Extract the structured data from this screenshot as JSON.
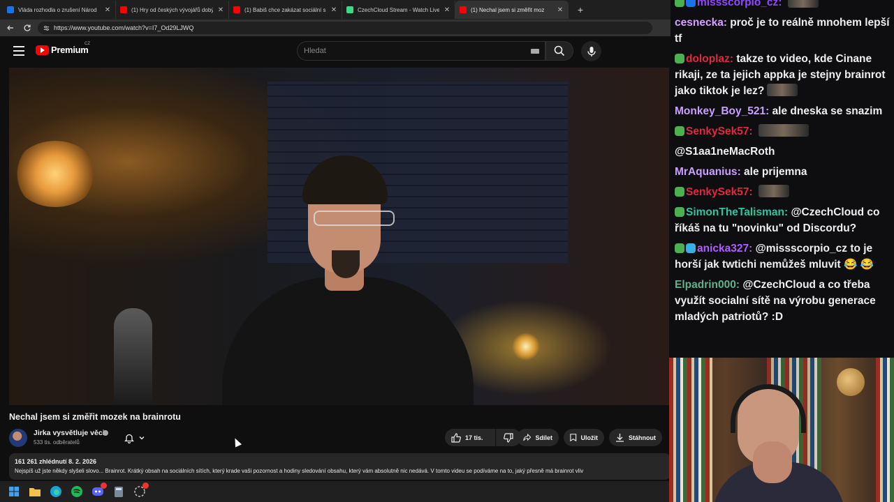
{
  "browser": {
    "tabs": [
      {
        "label": "Vláda rozhodla o zrušení Národ",
        "favicon_color": "#1a73e8",
        "active": false
      },
      {
        "label": "(1) Hry od českých vývojářů dobýv",
        "favicon_color": "#ff0000",
        "active": false
      },
      {
        "label": "(1) Babiš chce zakázat sociální sítě",
        "favicon_color": "#ff0000",
        "active": false
      },
      {
        "label": "CzechCloud Stream - Watch Live o",
        "favicon_color": "#3ddc84",
        "active": false
      },
      {
        "label": "(1) Nechal jsem si změřit moz",
        "favicon_color": "#ff0000",
        "active": true
      }
    ],
    "url": "https://www.youtube.com/watch?v=I7_Od29LJWQ"
  },
  "youtube": {
    "brand": "Premium",
    "region": "CZ",
    "search_placeholder": "Hledat",
    "video_title": "Nechal jsem si změřit mozek na brainrotu",
    "channel_name": "Jirka vysvětluje věci",
    "subscribers": "533 tis. odběratelů",
    "likes": "17 tis.",
    "share_label": "Sdílet",
    "save_label": "Uložit",
    "download_label": "Stáhnout",
    "views_date": "161 261 zhlédnutí  8. 2. 2026",
    "description": "Nejspíš už jste někdy slyšeli slovo... Brainrot. Krátký obsah na sociálních sítích, který krade vaši pozornost a hodiny sledování obsahu, který vám absolutně nic nedává. V tomto videu se podíváme na to, jaký přesně má brainrot vliv"
  },
  "chat": {
    "messages": [
      {
        "user": "missscorpio_cz",
        "user_color": "#9147ff",
        "badges": [
          "#4caf50",
          "#1a73e8"
        ],
        "text": "",
        "emote": true
      },
      {
        "user": "cesnecka",
        "user_color": "#d6a0ff",
        "badges": [],
        "text": "proč je to reálně mnohem lepší tf",
        "emote": false
      },
      {
        "user": "doloplaz",
        "user_color": "#e0293e",
        "badges": [
          "#4caf50"
        ],
        "text": "takze to video, kde Cinane rikaji, ze ta jejich appka je stejny brainrot jako tiktok je lez?",
        "emote": true
      },
      {
        "user": "Monkey_Boy_521",
        "user_color": "#c9a0ff",
        "badges": [],
        "text": "ale dneska se snazim",
        "emote": false
      },
      {
        "user": "SenkySek57",
        "user_color": "#e0293e",
        "badges": [
          "#4caf50"
        ],
        "text": "",
        "emote": true,
        "emote_wide": true
      },
      {
        "user": "",
        "user_color": "#efeff1",
        "badges": [],
        "text": "@S1aa1neMacRoth",
        "emote": false
      },
      {
        "user": "MrAquanius",
        "user_color": "#c9a0ff",
        "badges": [],
        "text": "ale prijemna",
        "emote": false
      },
      {
        "user": "SenkySek57",
        "user_color": "#e0293e",
        "badges": [
          "#4caf50"
        ],
        "text": "",
        "emote": true
      },
      {
        "user": "SimonTheTalisman",
        "user_color": "#2ec4a0",
        "badges": [
          "#4caf50"
        ],
        "text": "@CzechCloud co říkáš na tu \"novinku\" od Discordu?",
        "emote": false
      },
      {
        "user": "anicka327",
        "user_color": "#b05cff",
        "badges": [
          "#4caf50",
          "#3ab0e0"
        ],
        "text": "@missscorpio_cz to je horší jak twtichi nemůžeš mluvit 😂 😂",
        "emote": false
      },
      {
        "user": "Elpadrin000",
        "user_color": "#5fb38a",
        "badges": [],
        "text": "@CzechCloud a co třeba využít social­ní sítě na výrobu generace mladých patriotů? :D",
        "emote": false
      }
    ]
  }
}
